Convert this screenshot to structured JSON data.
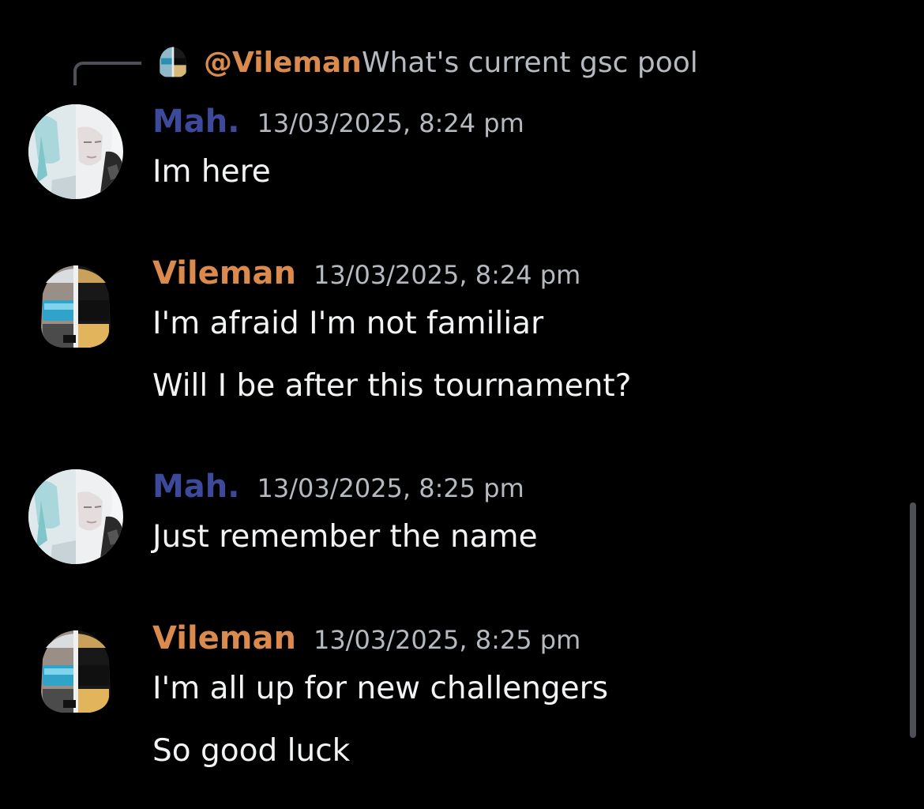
{
  "reply": {
    "author": "@Vileman",
    "text": "What's current gsc pool",
    "avatar_icon": "daft-punk-helmet-avatar"
  },
  "messages": [
    {
      "author": "Mah.",
      "timestamp": "13/03/2025, 8:24 pm",
      "avatar_icon": "anime-white-hair-avatar",
      "lines": [
        "Im here"
      ]
    },
    {
      "author": "Vileman",
      "timestamp": "13/03/2025, 8:24 pm",
      "avatar_icon": "daft-punk-helmet-avatar",
      "lines": [
        "I'm afraid I'm not familiar",
        "Will I be after this tournament?"
      ]
    },
    {
      "author": "Mah.",
      "timestamp": "13/03/2025, 8:25 pm",
      "avatar_icon": "anime-white-hair-avatar",
      "lines": [
        "Just remember the name"
      ]
    },
    {
      "author": "Vileman",
      "timestamp": "13/03/2025, 8:25 pm",
      "avatar_icon": "daft-punk-helmet-avatar",
      "lines": [
        "I'm all up for new challengers",
        "So good luck"
      ]
    }
  ],
  "colors": {
    "background": "#000000",
    "mah_name": "#3d4a9c",
    "vileman_name": "#d98a4c",
    "timestamp": "#b5bac1",
    "message_text": "#f2f3f5"
  }
}
